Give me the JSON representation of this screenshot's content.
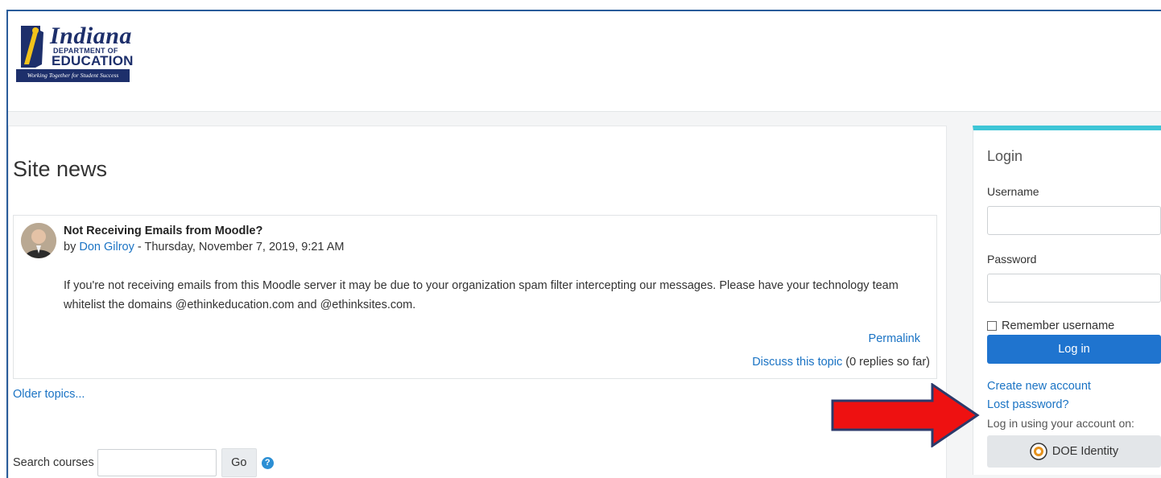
{
  "branding": {
    "logo_script": "Indiana",
    "logo_department": "DEPARTMENT OF",
    "logo_education": "EDUCATION",
    "logo_tagline": "Working Together for Student Success",
    "brand_navy": "#1d2f6b"
  },
  "site_news": {
    "heading": "Site news",
    "post": {
      "title": "Not Receiving Emails from Moodle?",
      "by_prefix": "by",
      "author": "Don Gilroy",
      "date_sep": " - Thursday, November 7, 2019, 9:21 AM",
      "body": "If you're not receiving emails from this Moodle server it may be due to your organization spam filter intercepting our messages. Please have your technology team whitelist the domains @ethinkeducation.com and @ethinksites.com.",
      "permalink": "Permalink",
      "discuss": "Discuss this topic",
      "replies": "(0 replies so far)"
    },
    "older_topics": "Older topics..."
  },
  "search": {
    "label": "Search courses",
    "go_label": "Go",
    "help_icon": "question-circle-icon",
    "help_glyph": "?"
  },
  "login": {
    "title": "Login",
    "username_label": "Username",
    "password_label": "Password",
    "remember_label": "Remember username",
    "login_button": "Log in",
    "create_account": "Create new account",
    "lost_password": "Lost password?",
    "sso_note": "Log in using your account on:",
    "sso_button": "DOE Identity",
    "accent_color": "#3ec6d6",
    "button_color": "#1f74cf"
  },
  "annotation": {
    "arrow_color": "#ee1111",
    "arrow_icon": "red-arrow-icon"
  }
}
